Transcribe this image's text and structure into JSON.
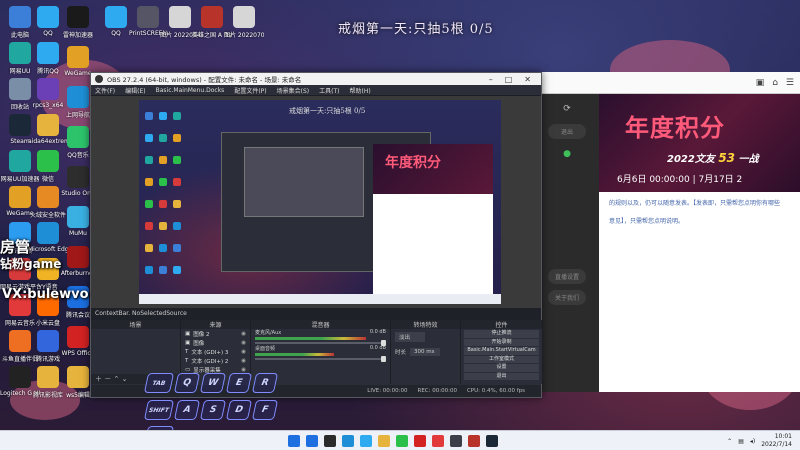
{
  "wallpaper": {
    "headline": "戒烟第一天:只抽5根 0/5"
  },
  "desktop_icons_left": [
    {
      "label": "此电脑",
      "icon": "computer-icon",
      "color": "#3c7fd8"
    },
    {
      "label": "网易UU",
      "icon": "uu-booster-icon",
      "color": "#1fa7a0"
    },
    {
      "label": "回收站",
      "icon": "recycle-bin-icon",
      "color": "#7a8ea8"
    },
    {
      "label": "Steam",
      "icon": "steam-icon",
      "color": "#1b2838"
    },
    {
      "label": "网易UU加速器",
      "icon": "uu-booster-icon",
      "color": "#1fa7a0"
    },
    {
      "label": "WeGame",
      "icon": "wegame-icon",
      "color": "#e2a024"
    },
    {
      "label": "腾讯视频",
      "icon": "tencent-video-icon",
      "color": "#2b9cf0"
    },
    {
      "label": "网易云游戏平台",
      "icon": "cloud-game-icon",
      "color": "#d63a3a"
    },
    {
      "label": "网易云音乐",
      "icon": "netease-music-icon",
      "color": "#e23a3a"
    },
    {
      "label": "斗鱼直播伴侣",
      "icon": "douyu-icon",
      "color": "#ee6e22"
    },
    {
      "label": "Logitech G HUB",
      "icon": "logitech-icon",
      "color": "#222"
    }
  ],
  "desktop_icons_col2": [
    {
      "label": "QQ",
      "icon": "qq-icon",
      "color": "#2daaf0"
    },
    {
      "label": "腾讯QQ",
      "icon": "qq-icon",
      "color": "#2daaf0"
    },
    {
      "label": "rpcs3_x64",
      "icon": "rpcs3-icon",
      "color": "#6b3fb5"
    },
    {
      "label": "aida64extreme",
      "icon": "folder-icon",
      "color": "#e6b43c"
    },
    {
      "label": "微信",
      "icon": "wechat-icon",
      "color": "#2bc04a"
    },
    {
      "label": "火绒安全软件",
      "icon": "huorong-icon",
      "color": "#e68a24"
    },
    {
      "label": "Microsoft Edge",
      "icon": "edge-icon",
      "color": "#1e8fd6"
    },
    {
      "label": "YY语音",
      "icon": "yy-icon",
      "color": "#f0b324"
    },
    {
      "label": "小米云盘",
      "icon": "xiaomi-icon",
      "color": "#ff6a00"
    },
    {
      "label": "腾讯游戏",
      "icon": "tencent-game-icon",
      "color": "#3366dd"
    },
    {
      "label": "腾讯影视库",
      "icon": "folder-icon",
      "color": "#e6b43c"
    }
  ],
  "desktop_icons_col3": [
    {
      "label": "雷神加速器",
      "icon": "booster-icon",
      "color": "#1a1a1a"
    },
    {
      "label": "WeGame",
      "icon": "wegame-icon",
      "color": "#e2a024"
    },
    {
      "label": "上网导航",
      "icon": "edge-icon",
      "color": "#1e8fd6"
    },
    {
      "label": "QQ音乐",
      "icon": "qq-music-icon",
      "color": "#2cc36b"
    },
    {
      "label": "Studio One",
      "icon": "studio-one-icon",
      "color": "#2d2d2d"
    },
    {
      "label": "MuMu",
      "icon": "emulator-icon",
      "color": "#3ab0e2"
    },
    {
      "label": "Afterburner",
      "icon": "afterburner-icon",
      "color": "#a01818"
    },
    {
      "label": "腾讯会议",
      "icon": "meeting-icon",
      "color": "#1b6fe0"
    },
    {
      "label": "WPS Office",
      "icon": "wps-icon",
      "color": "#d22222"
    },
    {
      "label": "ws5编辑",
      "icon": "folder-icon",
      "color": "#e6b43c"
    }
  ],
  "desktop_icons_top": [
    {
      "label": "QQ",
      "icon": "qq-icon",
      "color": "#2daaf0"
    },
    {
      "label": "PrintSCREEN",
      "icon": "screenshot-icon",
      "color": "#556"
    },
    {
      "label": "图片 2022054",
      "icon": "image-icon",
      "color": "#d6d6d6"
    },
    {
      "label": "英雄之国 A Dance of F...",
      "icon": "game-icon",
      "color": "#b8342a"
    },
    {
      "label": "图片 20220708",
      "icon": "image-icon",
      "color": "#d6d6d6"
    }
  ],
  "obs": {
    "title": "OBS 27.2.4 (64-bit, windows) - 配置文件: 未命名 - 场景: 未命名",
    "menu": [
      "文件(F)",
      "编辑(E)",
      "Basic.MainMenu.Docks",
      "配置文件(P)",
      "场景集合(S)",
      "工具(T)",
      "帮助(H)"
    ],
    "preview_caption": "戒烟第一天:只抽5根 0/5",
    "context_bar": "ContextBar. NoSelectedSource",
    "docks": {
      "scenes": "场景",
      "sources": "来源",
      "mixer": "混音器",
      "transitions": "转场特效",
      "controls": "控件"
    },
    "sources": [
      {
        "name": "图像 2",
        "icon": "image-icon"
      },
      {
        "name": "图像",
        "icon": "image-icon"
      },
      {
        "name": "文本 (GDI+) 3",
        "icon": "text-icon"
      },
      {
        "name": "文本 (GDI+) 2",
        "icon": "text-icon"
      },
      {
        "name": "显示器采集",
        "icon": "monitor-icon"
      }
    ],
    "mixer": [
      {
        "name": "麦克风/Aux",
        "db": "0.0 dB",
        "level": 0.85
      },
      {
        "name": "桌面音频",
        "db": "0.0 dB",
        "level": 0.6
      }
    ],
    "transition": {
      "type": "淡出",
      "duration_label": "时长",
      "duration": "300 ms"
    },
    "controls": [
      "停止推流",
      "开始录制",
      "Basic.Main.StartVirtualCam",
      "工作室模式",
      "设置",
      "退出"
    ],
    "status": {
      "live": "LIVE: 00:00:00",
      "rec": "REC: 00:00:00",
      "cpu": "CPU: 0.4%, 60.00 fps"
    }
  },
  "browser": {
    "banner_title": "年度积分",
    "banner_sub_year": "2022文友",
    "banner_sub_num": "53",
    "banner_sub_tail": "一战",
    "banner_dates": "6月6日 00:00:00 | 7月17日 2",
    "content_lines": [
      "的规则以及，仍可以随意发表。【发表即，只需帮您点明你有哪些",
      "意见】，只需帮您点明说明。"
    ],
    "nav_pill1": "退出",
    "nav_pill2": "直播设置",
    "nav_pill3": "关于我们"
  },
  "overlay": {
    "line1": "房管",
    "line2": "钻粉game",
    "vx": "VX:bulewvo"
  },
  "keyboard_overlay": {
    "row1": [
      "TAB",
      "Q",
      "W",
      "E",
      "R"
    ],
    "row2": [
      "SHIFT",
      "A",
      "S",
      "D",
      "F"
    ],
    "row3": [
      "CTRL"
    ]
  },
  "taskbar": {
    "time": "10:01",
    "date": "2022/7/14",
    "app_colors": [
      "#1e6fe0",
      "#2b2b2b",
      "#1e8fd6",
      "#2daaf0",
      "#e6b43c",
      "#2bc04a",
      "#d22222",
      "#e23a3a",
      "#3c3f4a",
      "#b8342a",
      "#1b2838"
    ]
  }
}
